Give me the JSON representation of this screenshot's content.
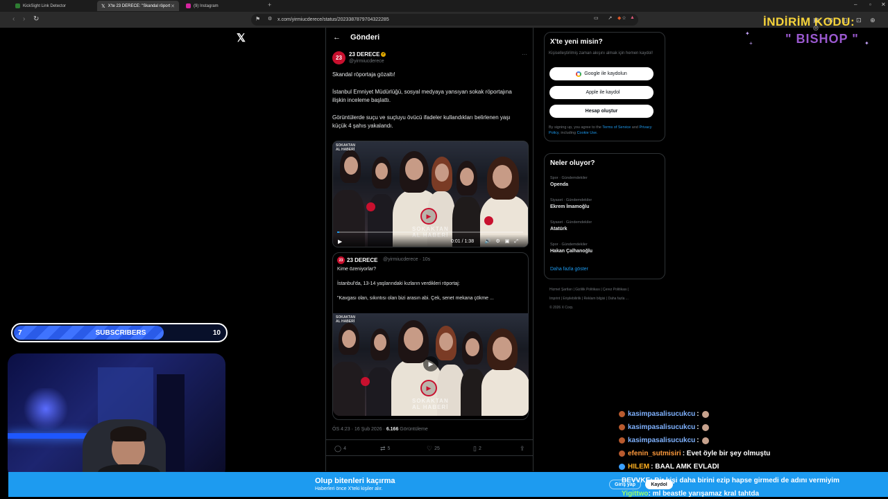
{
  "browser": {
    "tabs": [
      {
        "label": "KickSight Link Detector",
        "color": "#2e7d32"
      },
      {
        "label": "X'te 23 DERECE: \"Skandal röport",
        "color": "#ffffff"
      },
      {
        "label": "(9) Instagram",
        "color": "#d6249f"
      }
    ],
    "url": "x.com/yirmiucderece/status/2023387879704322285"
  },
  "x_page": {
    "header_title": "Gönderi",
    "post": {
      "avatar_text": "23",
      "author": "23 DERECE",
      "handle": "@yirmiucderece",
      "text_lines": [
        "Skandal röportaja gözaltı!",
        "İstanbul Emniyet Müdürlüğü, sosyal medyaya yansıyan sokak röportajına",
        "ilişkin inceleme başlattı.",
        "Görüntülerde suçu ve suçluyu övücü ifadeler kullandıkları belirlenen yaşı",
        "küçük 4 şahıs yakalandı."
      ],
      "video": {
        "caption_tag": [
          "SOKAKTAN",
          "AL HABERİ"
        ],
        "brand_text": [
          "SOKAKTAN",
          "AL HABERİ"
        ],
        "time": "0:01 / 1:38",
        "progress": 0.01
      },
      "quote": {
        "avatar_text": "23",
        "author": "23 DERECE",
        "handle": "@yirmiucderece · 10s",
        "lines": [
          "Kime özeniyorlar?",
          "İstanbul'da, 13-14 yaşlarındaki kızların verdikleri röportaj:",
          "\"Kavgası olan, sıkıntısı olan bizi arasın abi. Çek, senet mekana çökme ..."
        ],
        "caption_tag": [
          "SOKAKTAN",
          "AL HABERİ"
        ],
        "brand_text": [
          "SOKAKTAN",
          "AL HABERİ"
        ]
      },
      "meta_time": "ÖS 4:23 · 16 Şub 2026 · ",
      "views_count": "6.166",
      "views_label": " Görüntüleme",
      "actions": {
        "replies": "4",
        "reposts": "5",
        "likes": "25",
        "bookmarks": "2"
      }
    },
    "signup_box": {
      "title": "X'te yeni misin?",
      "subtitle": "Kişiselleştirilmiş zaman akışını almak için hemen kaydol!",
      "google": "Google ile kaydolun",
      "apple": "Apple ile kaydol",
      "create": "Hesap oluştur",
      "legal_pre": "By signing up, you agree to the ",
      "terms": "Terms of Service",
      "and": " and ",
      "privacy": "Privacy Policy",
      "including": ", including ",
      "cookie": "Cookie Use."
    },
    "trends": {
      "title": "Neler oluyor?",
      "items": [
        {
          "category": "Spor · Gündemdekiler",
          "title": "Openda"
        },
        {
          "category": "Siyaset · Gündemdekiler",
          "title": "Ekrem İmamoğlu"
        },
        {
          "category": "Siyaset · Gündemdekiler",
          "title": "Atatürk"
        },
        {
          "category": "Spor · Gündemdekiler",
          "title": "Hakan Çalhanoğlu"
        }
      ],
      "show_more": "Daha fazla göster"
    },
    "footer_lines": [
      "Hizmet Şartları  |  Gizlilik Politikası  |  Çerez Politikası  |",
      "Imprint  |  Erişilebilirlik  |  Reklam bilgisi  |  Daha fazla ...",
      "© 2026 X Corp."
    ],
    "bottom_bar": {
      "title": "Olup bitenleri kaçırma",
      "subtitle": "Haberleri önce X'teki kişiler alır.",
      "login": "Giriş yap",
      "signup": "Kaydol"
    }
  },
  "stream": {
    "promo_line1": "İNDİRİM KODU:",
    "promo_line2": "\" BISHOP \"",
    "subscribers": {
      "current": "7",
      "label": "SUBSCRIBERS",
      "goal": "10",
      "progress": 0.7
    },
    "chat": [
      {
        "user": "kasimpasalisucukcu",
        "message": ":",
        "color": "#7fb2ff",
        "emoji": true
      },
      {
        "user": "kasimpasalisucukcu",
        "message": ":",
        "color": "#7fb2ff",
        "emoji": true
      },
      {
        "user": "kasimpasalisucukcu",
        "message": ":",
        "color": "#7fb2ff",
        "emoji": true
      },
      {
        "user": "efenin_sutmisiri",
        "message": ": Evet öyle bir şey olmuştu",
        "color": "#ff9a3c",
        "emoji": false
      },
      {
        "user": "HILEM",
        "message": ": BAAL AMK EVLADI",
        "color": "#ffb020",
        "emoji": false
      }
    ],
    "chat_overlay": [
      {
        "user": "BEVVKE",
        "message": ": Bir kişi daha birini ezip hapse girmedi de adını vermiyim",
        "color": "#ffffff"
      },
      {
        "user": "Yigittwo",
        "message": ": ml beastle yarışamaz kral tahtda",
        "color": "#9cff6a"
      }
    ]
  }
}
